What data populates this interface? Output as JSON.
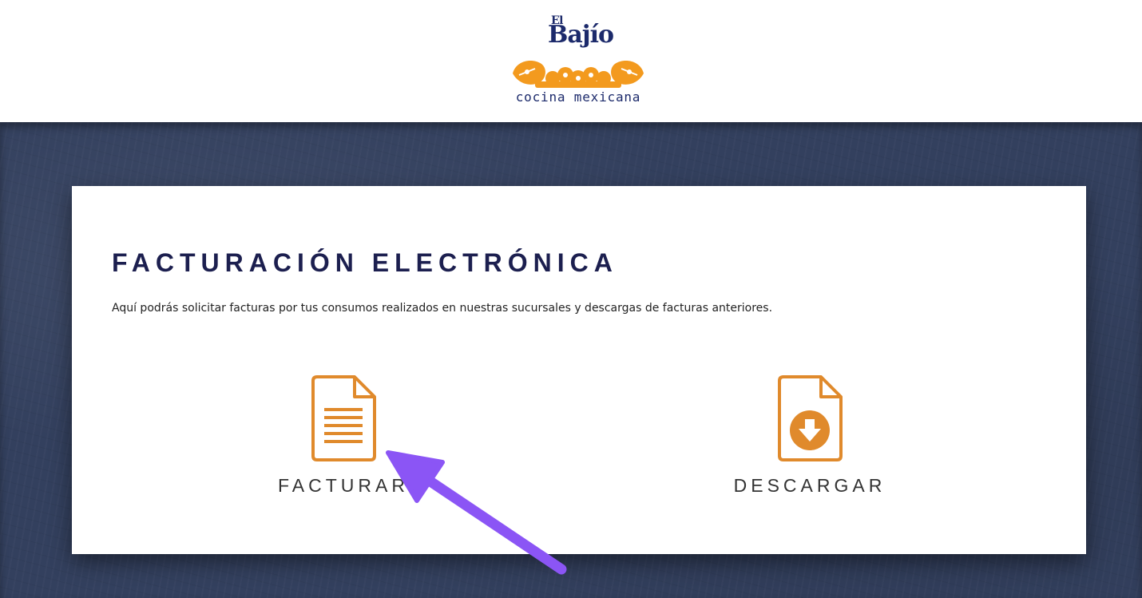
{
  "brand": {
    "logo_small": "El",
    "logo_name": "Bajío",
    "logo_tagline": "cocina mexicana"
  },
  "main": {
    "title": "FACTURACIÓN ELECTRÓNICA",
    "description": "Aquí podrás solicitar facturas por tus consumos realizados en nuestras sucursales y descargas de facturas anteriores.",
    "actions": [
      {
        "label": "FACTURAR",
        "icon": "document-lines-icon"
      },
      {
        "label": "DESCARGAR",
        "icon": "document-download-icon"
      }
    ]
  },
  "colors": {
    "brand_navy": "#1c2a6b",
    "accent_orange": "#e08a2c",
    "backdrop": "#33405e",
    "pointer_arrow": "#8b55f5"
  }
}
